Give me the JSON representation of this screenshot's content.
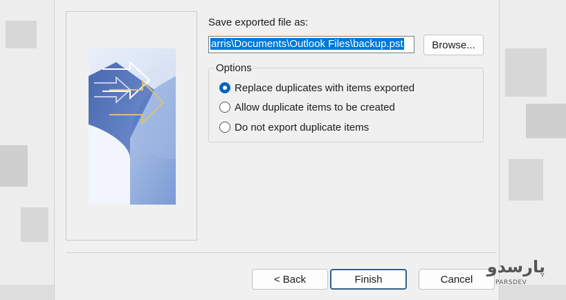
{
  "dialog": {
    "save_label": "Save exported file as:",
    "file_path_value": "arris\\Documents\\Outlook Files\\backup.pst",
    "browse_label": "Browse...",
    "options_title": "Options",
    "options": [
      {
        "label": "Replace duplicates with items exported",
        "selected": true
      },
      {
        "label": "Allow duplicate items to be created",
        "selected": false
      },
      {
        "label": "Do not export duplicate items",
        "selected": false
      }
    ],
    "back_label": "< Back",
    "finish_label": "Finish",
    "cancel_label": "Cancel"
  },
  "watermark": {
    "text_farsi": "پارسدو",
    "text_latin": "PARSDEV"
  },
  "colors": {
    "accent": "#0067c0",
    "selection": "#0078d7",
    "primary_button_border": "#2f5f86"
  }
}
